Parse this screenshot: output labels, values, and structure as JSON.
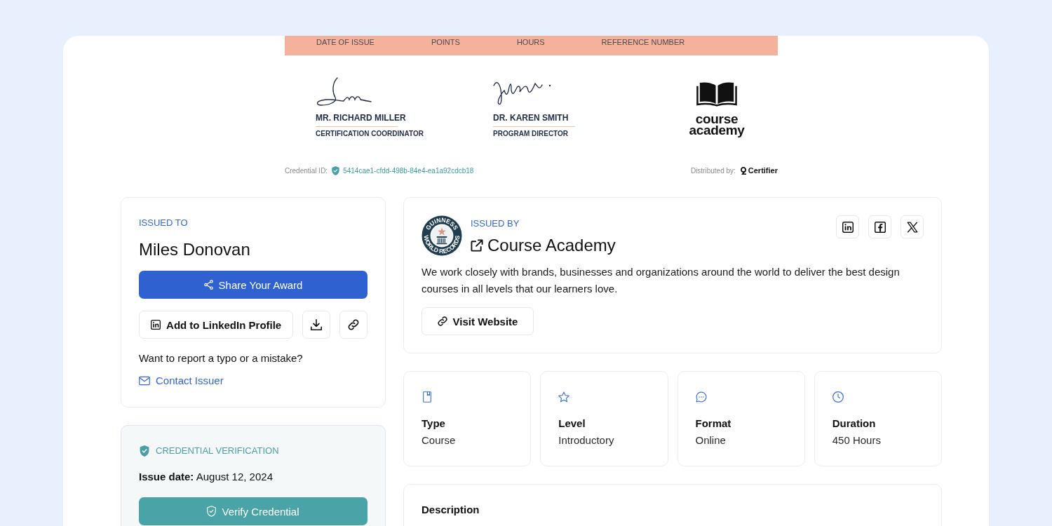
{
  "certificate": {
    "header_labels": [
      "DATE OF ISSUE",
      "POINTS",
      "HOURS",
      "REFERENCE NUMBER"
    ],
    "signatories": [
      {
        "name": "MR. RICHARD MILLER",
        "role": "CERTIFICATION COORDINATOR"
      },
      {
        "name": "DR. KAREN SMITH",
        "role": "PROGRAM DIRECTOR"
      }
    ],
    "logo": {
      "wordmark": "course academy"
    },
    "credential_id": {
      "label": "Credential ID:",
      "value": "5414cae1-cfdd-498b-84e4-ea1a92cdcb18"
    },
    "distributed_by": {
      "label": "Distributed by:",
      "brand": "Certifier"
    }
  },
  "recipient": {
    "heading": "ISSUED TO",
    "name": "Miles Donovan",
    "share_button": "Share Your Award",
    "linkedin_button": "Add to LinkedIn Profile",
    "report_prompt": "Want to report a typo or a mistake?",
    "contact_link": "Contact Issuer"
  },
  "verification": {
    "heading": "CREDENTIAL VERIFICATION",
    "issue_date": "**Issue date:** August 12, 2024",
    "verify_button": "Verify Credential"
  },
  "issuer": {
    "badge_text": [
      "GUINNESS",
      "WORLD RECORDS"
    ],
    "heading": "ISSUED BY",
    "name": "Course Academy",
    "description": "We work closely with brands, businesses and organizations around the world to deliver the best design courses in all levels that our learners love.",
    "website_button": "Visit Website"
  },
  "details": [
    {
      "kind": "type",
      "label": "Type",
      "value": "Course"
    },
    {
      "kind": "level",
      "label": "Level",
      "value": "Introductory"
    },
    {
      "kind": "format",
      "label": "Format",
      "value": "Online"
    },
    {
      "kind": "duration",
      "label": "Duration",
      "value": "450 Hours"
    }
  ],
  "description": {
    "heading": "Description"
  }
}
